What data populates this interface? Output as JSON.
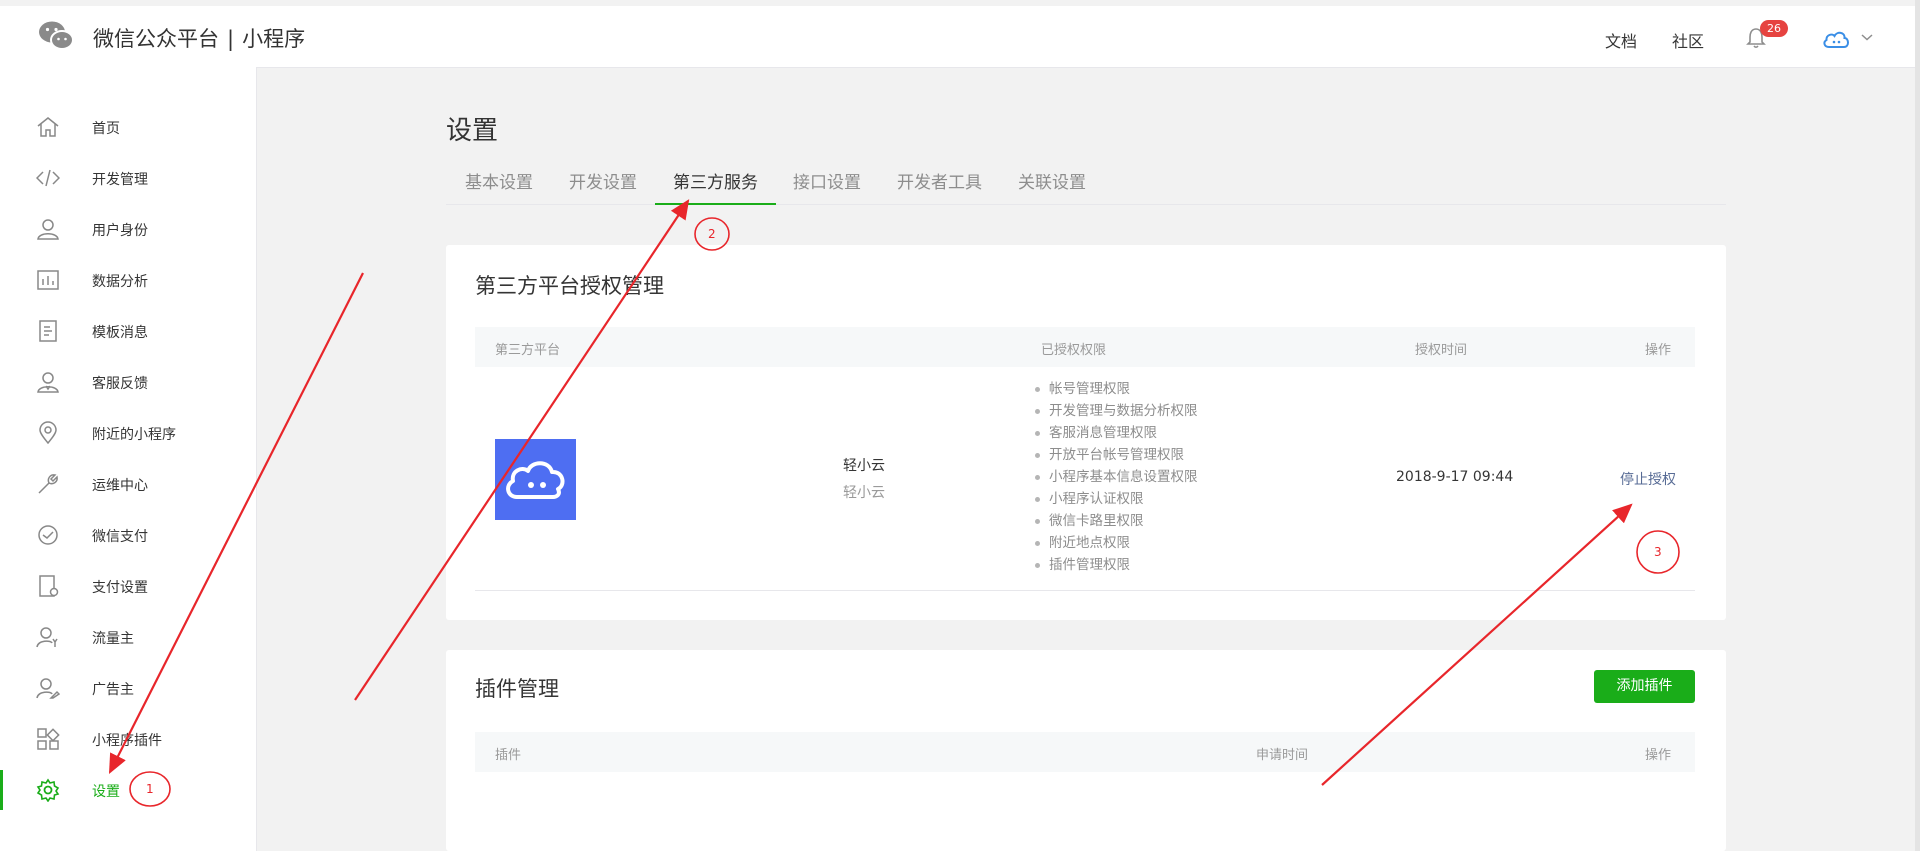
{
  "header": {
    "brand": "微信公众平台",
    "separator": "|",
    "product": "小程序",
    "docs_label": "文档",
    "community_label": "社区",
    "notification_count": "26"
  },
  "sidebar": {
    "items": [
      {
        "label": "首页",
        "icon": "home-icon"
      },
      {
        "label": "开发管理",
        "icon": "code-icon"
      },
      {
        "label": "用户身份",
        "icon": "user-icon"
      },
      {
        "label": "数据分析",
        "icon": "bar-chart-icon"
      },
      {
        "label": "模板消息",
        "icon": "document-icon"
      },
      {
        "label": "客服反馈",
        "icon": "support-icon"
      },
      {
        "label": "附近的小程序",
        "icon": "location-pin-icon"
      },
      {
        "label": "运维中心",
        "icon": "wrench-icon"
      },
      {
        "label": "微信支付",
        "icon": "payment-icon"
      },
      {
        "label": "支付设置",
        "icon": "payment-settings-icon"
      },
      {
        "label": "流量主",
        "icon": "traffic-owner-icon"
      },
      {
        "label": "广告主",
        "icon": "advertiser-icon"
      },
      {
        "label": "小程序插件",
        "icon": "plugin-icon"
      },
      {
        "label": "设置",
        "icon": "gear-icon",
        "active": true
      }
    ]
  },
  "main": {
    "title": "设置",
    "tabs": [
      {
        "label": "基本设置"
      },
      {
        "label": "开发设置"
      },
      {
        "label": "第三方服务",
        "active": true
      },
      {
        "label": "接口设置"
      },
      {
        "label": "开发者工具"
      },
      {
        "label": "关联设置"
      }
    ]
  },
  "third_party": {
    "title": "第三方平台授权管理",
    "columns": [
      "第三方平台",
      "已授权权限",
      "授权时间",
      "操作"
    ],
    "row": {
      "name": "轻小云",
      "sub_name": "轻小云",
      "permissions": [
        "帐号管理权限",
        "开发管理与数据分析权限",
        "客服消息管理权限",
        "开放平台帐号管理权限",
        "小程序基本信息设置权限",
        "小程序认证权限",
        "微信卡路里权限",
        "附近地点权限",
        "插件管理权限"
      ],
      "auth_time": "2018-9-17 09:44",
      "action": "停止授权"
    }
  },
  "plugins": {
    "title": "插件管理",
    "add_button": "添加插件",
    "columns": [
      "插件",
      "申请时间",
      "操作"
    ]
  },
  "annotations": {
    "step1": "1",
    "step2": "2",
    "step3": "3"
  },
  "colors": {
    "accent_green": "#1aad19",
    "link_blue": "#576b95",
    "badge_red": "#e64340",
    "app_logo_blue": "#4e6ef2",
    "annotation_red": "#e8262b"
  }
}
